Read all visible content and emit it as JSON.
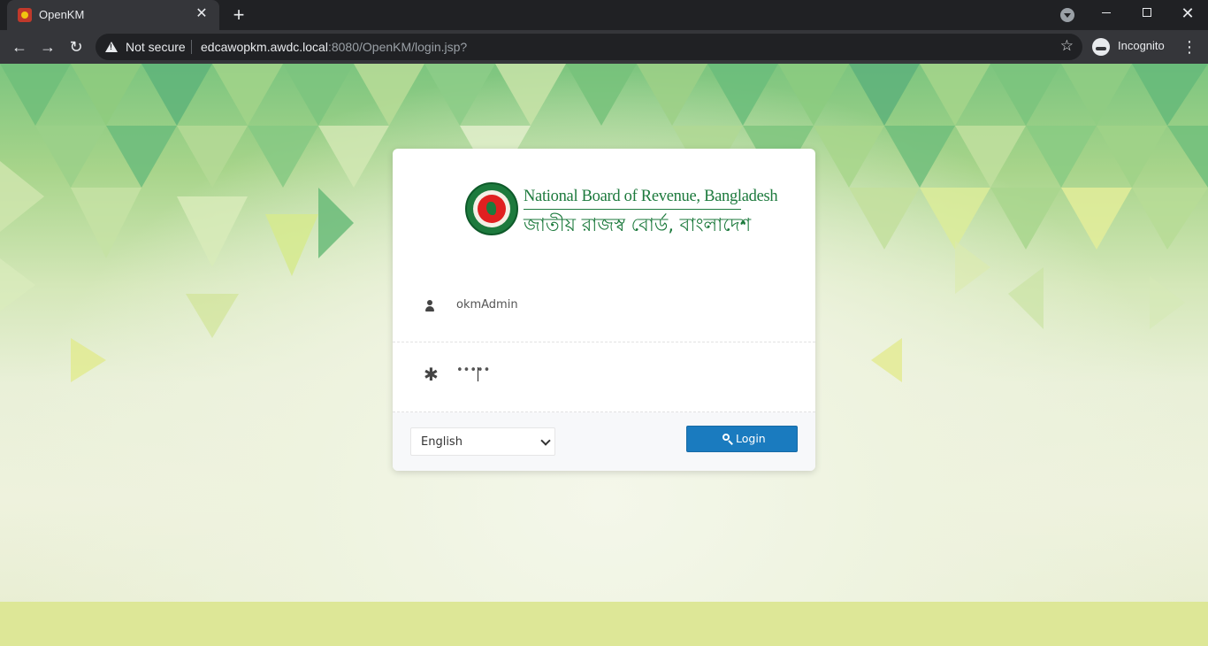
{
  "browser": {
    "tab_title": "OpenKM",
    "security_label": "Not secure",
    "url_host": "edcawopkm.awdc.local",
    "url_rest": ":8080/OpenKM/login.jsp?",
    "profile_label": "Incognito"
  },
  "login": {
    "logo_title_en": "National Board of Revenue, Bangladesh",
    "logo_title_bn": "জাতীয় রাজস্ব বোর্ড, বাংলাদেশ",
    "username_value": "okmAdmin",
    "password_value": "•••••",
    "language_selected": "English",
    "login_button": "Login"
  },
  "colors": {
    "primary_button": "#1a7bbf",
    "logo_green": "#1d7a3d",
    "footer_band": "#dde797"
  },
  "icons": [
    "tab-favicon-icon",
    "close-icon",
    "plus-icon",
    "back-icon",
    "forward-icon",
    "reload-icon",
    "warning-icon",
    "star-icon",
    "incognito-icon",
    "kebab-menu-icon",
    "user-icon",
    "asterisk-icon",
    "chevron-down-icon",
    "key-icon"
  ]
}
